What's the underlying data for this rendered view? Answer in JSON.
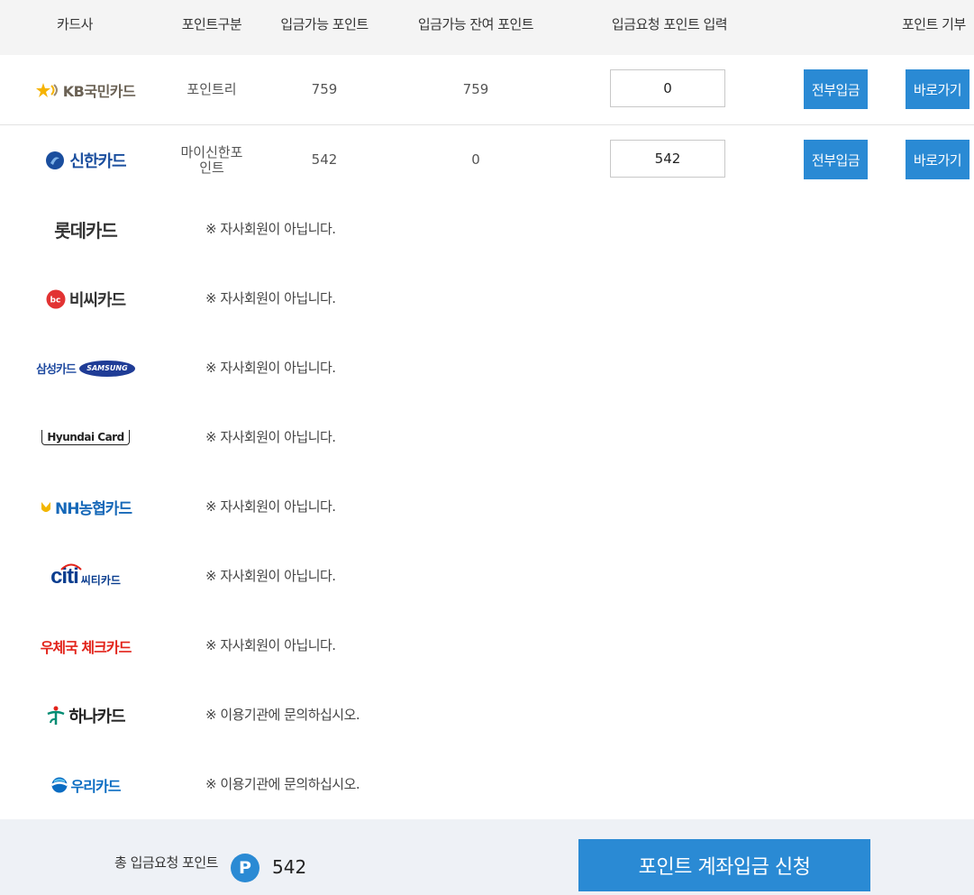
{
  "header": {
    "col_card": "카드사",
    "col_type": "포인트구분",
    "col_available": "입금가능 포인트",
    "col_remaining": "입금가능 잔여 포인트",
    "col_request": "입금요청 포인트 입력",
    "col_donate": "포인트 기부"
  },
  "cards": [
    {
      "logo": "KB국민카드",
      "point_type": "포인트리",
      "available": "759",
      "remaining": "759",
      "request": "0",
      "deposit_all": "전부입금",
      "go": "바로가기"
    },
    {
      "logo": "신한카드",
      "point_type": "마이신한포인트",
      "available": "542",
      "remaining": "0",
      "request": "542",
      "deposit_all": "전부입금",
      "go": "바로가기"
    },
    {
      "logo": "롯데카드",
      "message": "※ 자사회원이 아닙니다."
    },
    {
      "logo": "비씨카드",
      "message": "※ 자사회원이 아닙니다."
    },
    {
      "logo": "삼성카드",
      "logo_sub": "SAMSUNG",
      "message": "※ 자사회원이 아닙니다."
    },
    {
      "logo": "Hyundai Card",
      "message": "※ 자사회원이 아닙니다."
    },
    {
      "logo": "NH농협카드",
      "message": "※ 자사회원이 아닙니다."
    },
    {
      "logo": "citi",
      "logo_sub": "씨티카드",
      "message": "※ 자사회원이 아닙니다."
    },
    {
      "logo": "우체국 체크카드",
      "message": "※ 자사회원이 아닙니다."
    },
    {
      "logo": "하나카드",
      "message": "※ 이용기관에 문의하십시오."
    },
    {
      "logo": "우리카드",
      "message": "※ 이용기관에 문의하십시오."
    }
  ],
  "footer": {
    "total_label": "총 입금요청 포인트",
    "p_icon": "P",
    "total_value": "542",
    "submit_label": "포인트 계좌입금 신청"
  },
  "colors": {
    "accent": "#2a8ad4",
    "header_bg": "#f4f4f4",
    "footer_bg": "#eef1f6"
  }
}
